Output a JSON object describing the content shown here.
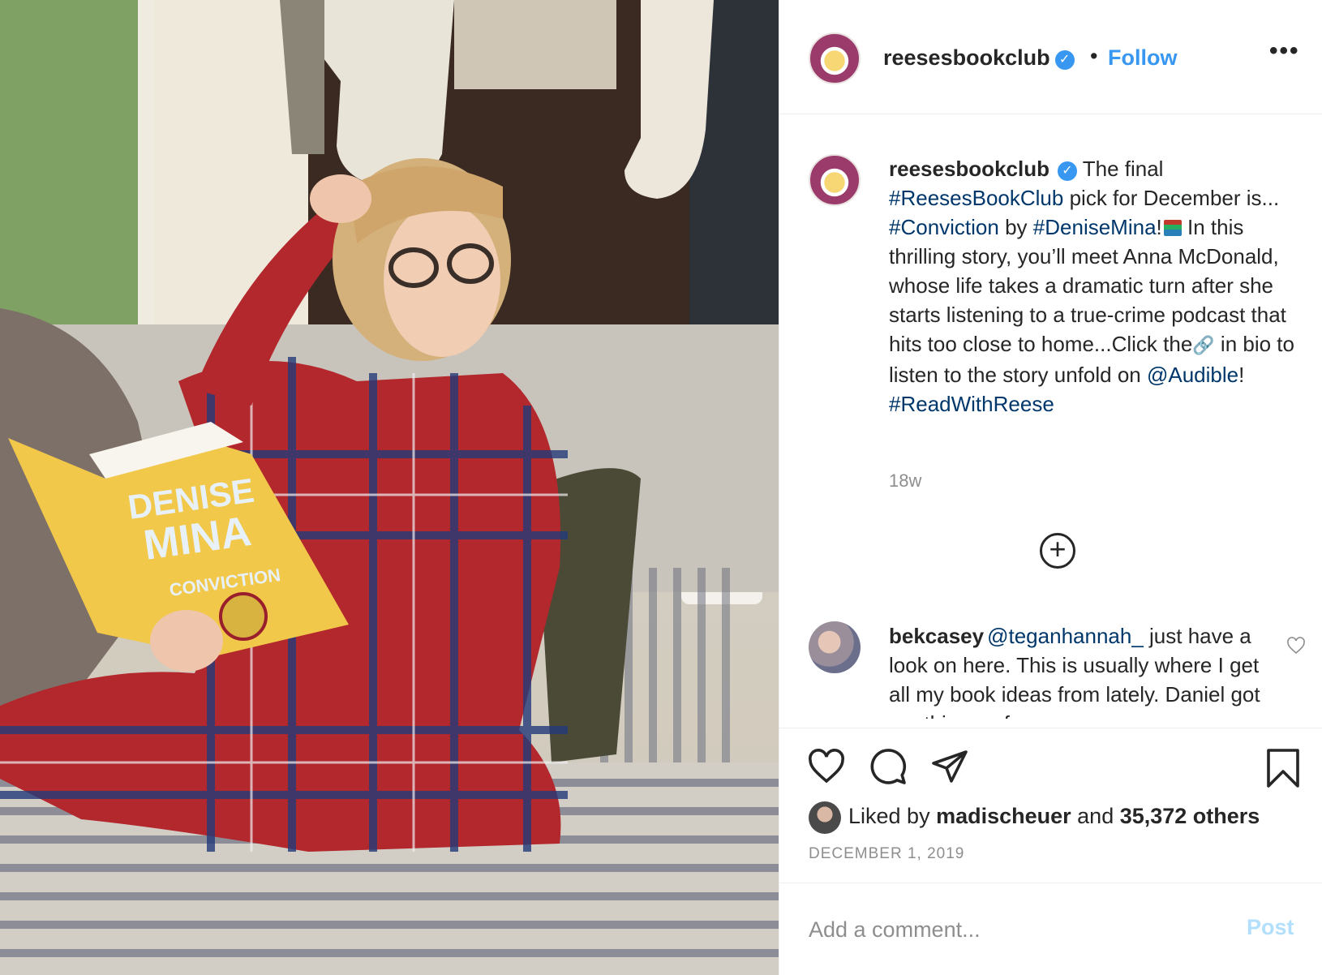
{
  "post": {
    "username": "reesesbookclub",
    "verified_mark": "✓",
    "dot": "•",
    "follow_label": "Follow",
    "more_label": "•••"
  },
  "caption": {
    "username": "reesesbookclub",
    "verified_mark": "✓",
    "segments": {
      "t1": " The final ",
      "h1": "#ReesesBookClub",
      "t2": " pick for December is... ",
      "h2": "#Conviction",
      "t3": " by ",
      "h3": "#DeniseMina",
      "t4": "!",
      "t5": " In this thrilling story, you’ll meet Anna McDonald, whose life takes a dramatic turn after she starts listening to a true-crime podcast that hits too close to home...Click the",
      "link_emoji": "🔗",
      "t6": " in bio to listen to the story unfold on ",
      "h4": "@Audible",
      "t7": "!",
      "h5": "#ReadWithReese"
    },
    "timestamp": "18w"
  },
  "load_more_label": "+",
  "comment": {
    "username": "bekcasey",
    "mention": "@teganhannah_",
    "text": " just have a look on here. This is usually where I get all my book ideas from lately. Daniel got me this one for"
  },
  "likes": {
    "prefix": "Liked by ",
    "user": "madischeuer",
    "middle": " and ",
    "count": "35,372 others"
  },
  "date": "DECEMBER 1, 2019",
  "add_comment": {
    "placeholder": "Add a comment...",
    "post_label": "Post"
  },
  "colors": {
    "accent": "#3897f0",
    "hashtag": "#00376b",
    "muted": "#8e8e8e",
    "post_disabled": "#b2dffc"
  },
  "icons": [
    "heart-icon",
    "comment-icon",
    "share-icon",
    "bookmark-icon",
    "add-circle-icon",
    "verified-badge-icon",
    "more-options-icon"
  ]
}
